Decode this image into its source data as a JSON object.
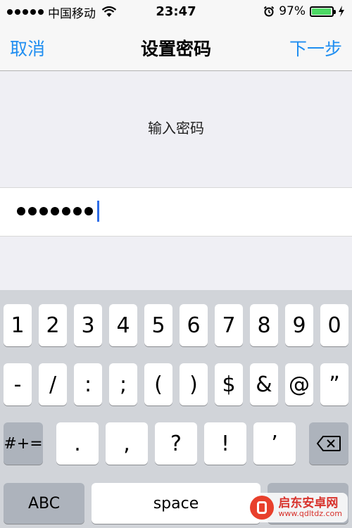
{
  "status_bar": {
    "carrier": "中国移动",
    "time": "23:47",
    "battery_percent": "97%",
    "battery_level": 0.97
  },
  "nav": {
    "cancel_label": "取消",
    "title": "设置密码",
    "next_label": "下一步"
  },
  "content": {
    "prompt": "输入密码",
    "password_length": 7
  },
  "keyboard": {
    "row1": [
      "1",
      "2",
      "3",
      "4",
      "5",
      "6",
      "7",
      "8",
      "9",
      "0"
    ],
    "row2": [
      "-",
      "/",
      ":",
      ";",
      "(",
      ")",
      "$",
      "&",
      "@",
      "”"
    ],
    "row3": [
      ".",
      ",",
      "?",
      "!",
      "’"
    ],
    "symbols_label": "#+=",
    "abc_label": "ABC",
    "space_label": "space"
  },
  "watermark": {
    "name": "启东安卓网",
    "url": "www.qdltdz.com"
  },
  "colors": {
    "accent": "#1f8ef1",
    "battery": "#4cd964",
    "caret": "#2f6ee8"
  }
}
